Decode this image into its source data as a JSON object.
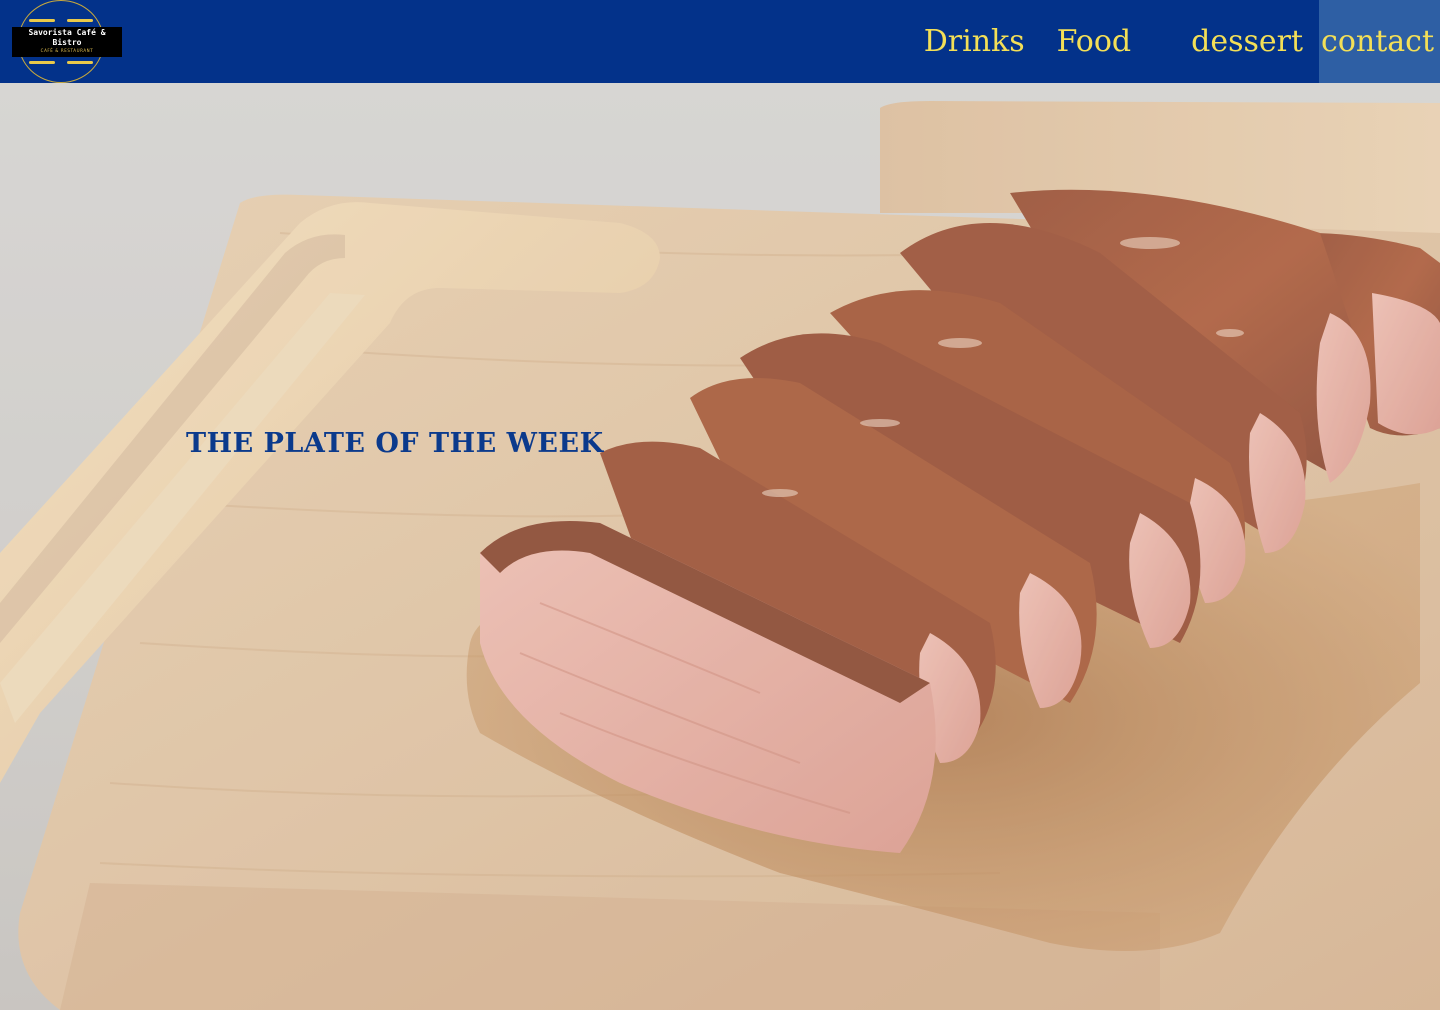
{
  "header": {
    "logo": {
      "name": "Savorista Café & Bistro",
      "tagline": "CAFÉ & RESTAURANT"
    },
    "nav": [
      {
        "label": "Drinks"
      },
      {
        "label": "Food"
      },
      {
        "label": "dessert"
      },
      {
        "label": "contact",
        "active": true
      }
    ]
  },
  "hero": {
    "title": "The plate of the week",
    "image": "roast-pork-on-cutting-board"
  },
  "colors": {
    "header_bg": "#03328a",
    "nav_text": "#f3df57",
    "nav_active_bg": "#2e5fa4",
    "title_text": "#0b3a8c"
  }
}
